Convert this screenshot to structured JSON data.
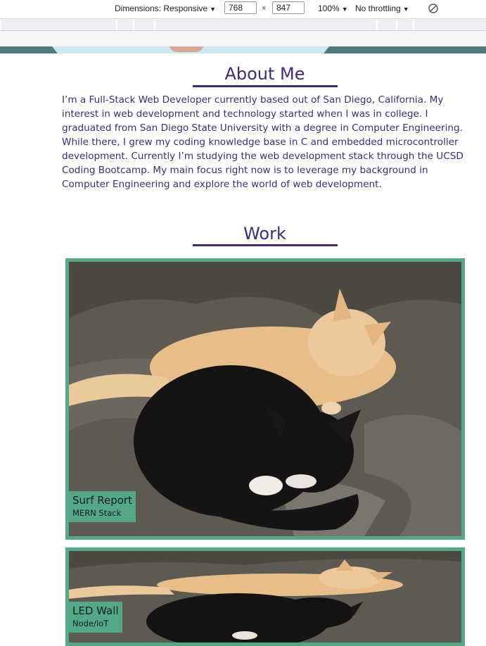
{
  "devtools": {
    "dimensions_label": "Dimensions: Responsive",
    "width_value": "768",
    "height_value": "847",
    "times_symbol": "×",
    "zoom_label": "100%",
    "throttling_label": "No throttling",
    "caret": "▼"
  },
  "about": {
    "title": "About Me",
    "body": "I’m a Full-Stack Web Developer currently based out of San Diego, California. My interest in web development and technology started when I was in college. I graduated from San Diego State University with a degree in Computer Engineering. While there, I grew my coding knowledge base in C and embedded microcontroller development. Currently I’m studying the web development stack through the UCSD Coding Bootcamp. My main focus right now is to leverage my background in Computer Engineering and explore the world of web development."
  },
  "work": {
    "title": "Work",
    "projects": [
      {
        "title": "Surf Report",
        "subtitle": "MERN Stack"
      },
      {
        "title": "LED Wall",
        "subtitle": "Node/IoT"
      }
    ]
  },
  "colors": {
    "accent_purple": "#3f2b7a",
    "card_green": "#54a887"
  }
}
